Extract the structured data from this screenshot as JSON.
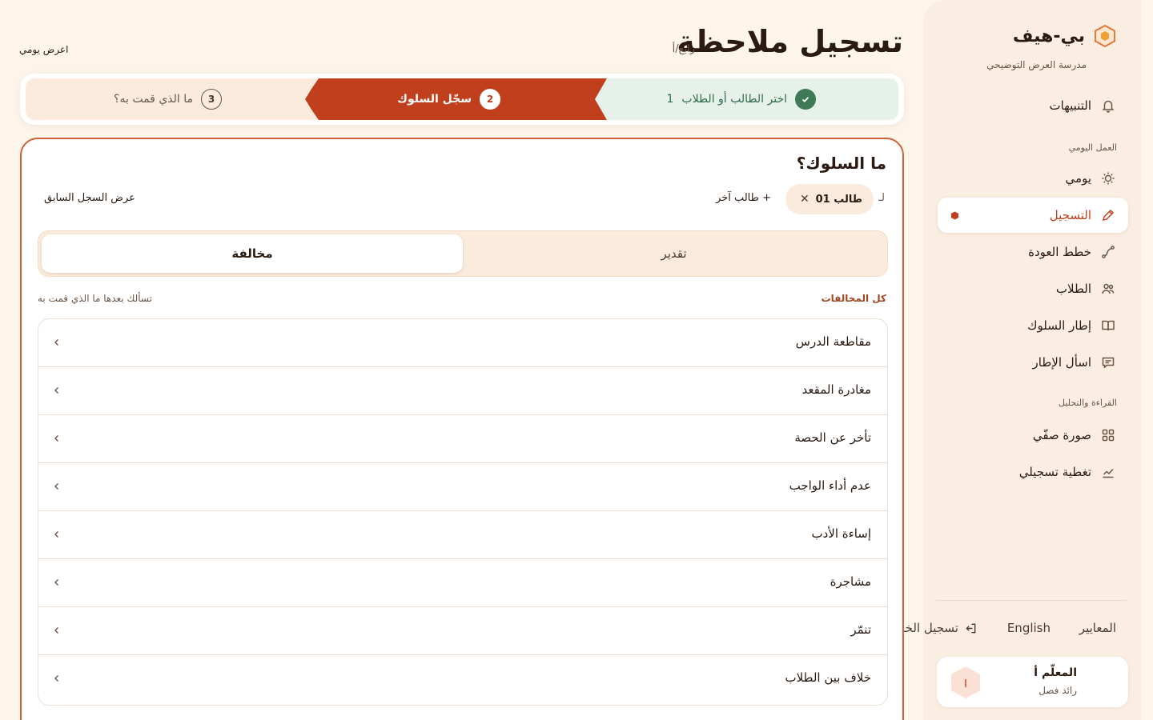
{
  "brand": {
    "name": "بي-هيف",
    "subtitle": "مدرسة العرض التوضيحي"
  },
  "nav": {
    "notifications": "التنبيهات",
    "section_daily": "العمل اليومي",
    "daily": "يومي",
    "log": "التسجيل",
    "recovery": "خطط العودة",
    "students": "الطلاب",
    "framework": "إطار السلوك",
    "framework_qs": "اسأل الإطار",
    "section_reading": "القراءة والتحليل",
    "class_picture": "صورة صفّي",
    "log_coverage": "تغطية تسجيلي"
  },
  "footer": {
    "standards": "المعايير",
    "language": "English",
    "logout": "تسجيل الخروج"
  },
  "user": {
    "name": "المعلّم أ",
    "role": "رائد فصل",
    "initial": "I"
  },
  "header": {
    "title": "تسجيل ملاحظة",
    "subtitle": "رابع/أ",
    "view_daily": "اعرض يومي"
  },
  "stepper": {
    "steps": [
      {
        "label": "اختر الطالب أو الطلاب",
        "num": "1",
        "state": "done",
        "count": "1",
        "icon": "check-icon"
      },
      {
        "label": "سجّل السلوك",
        "num": "2",
        "state": "active"
      },
      {
        "label": "ما الذي قمت به؟",
        "num": "3",
        "state": "pending"
      }
    ]
  },
  "form": {
    "question": "ما السلوك؟",
    "for_label": "لـ",
    "student_chip": "طالب 01",
    "add_student": "+ طالب آخر",
    "prev_log": "عرض السجل السابق",
    "seg_appreciation": "تقدير",
    "seg_violation": "مخالفة",
    "all_violations": "كل المخالفات",
    "hint": "تسألك بعدها ما الذي قمت به"
  },
  "violations": [
    "مقاطعة الدرس",
    "مغادرة المقعد",
    "تأخر عن الحصة",
    "عدم أداء الواجب",
    "إساءة الأدب",
    "مشاجرة",
    "تنمّر",
    "خلاف بين الطلاب"
  ],
  "colors": {
    "accent": "#c0401e",
    "done_bg": "#e6f1ea",
    "done_text": "#2f6b4a",
    "pending_bg": "#faebdc",
    "page_bg": "#fdf4ea"
  }
}
